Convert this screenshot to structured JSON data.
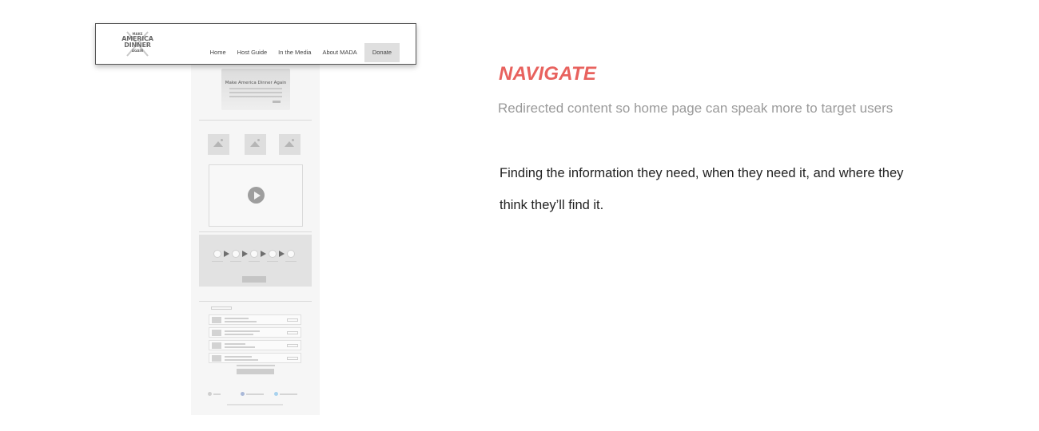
{
  "header": {
    "logo": {
      "line1": "MAKE",
      "line2": "AMERICA",
      "line3": "DINNER",
      "line4": "AGAIN"
    },
    "nav": [
      {
        "label": "Home"
      },
      {
        "label": "Host Guide"
      },
      {
        "label": "In the Media"
      },
      {
        "label": "About MADA"
      },
      {
        "label": "Donate"
      }
    ]
  },
  "wireframe": {
    "hero_title": "Make America Dinner Again"
  },
  "content": {
    "heading": "NAVIGATE",
    "subheading": "Redirected content so home page can speak more to target users",
    "body": "Finding the information they need, when they need it, and where they think they’ll find it."
  },
  "colors": {
    "accent": "#e8625e",
    "subtle_text": "#9a9a9a",
    "nav_highlight": "#dfdfdf"
  }
}
